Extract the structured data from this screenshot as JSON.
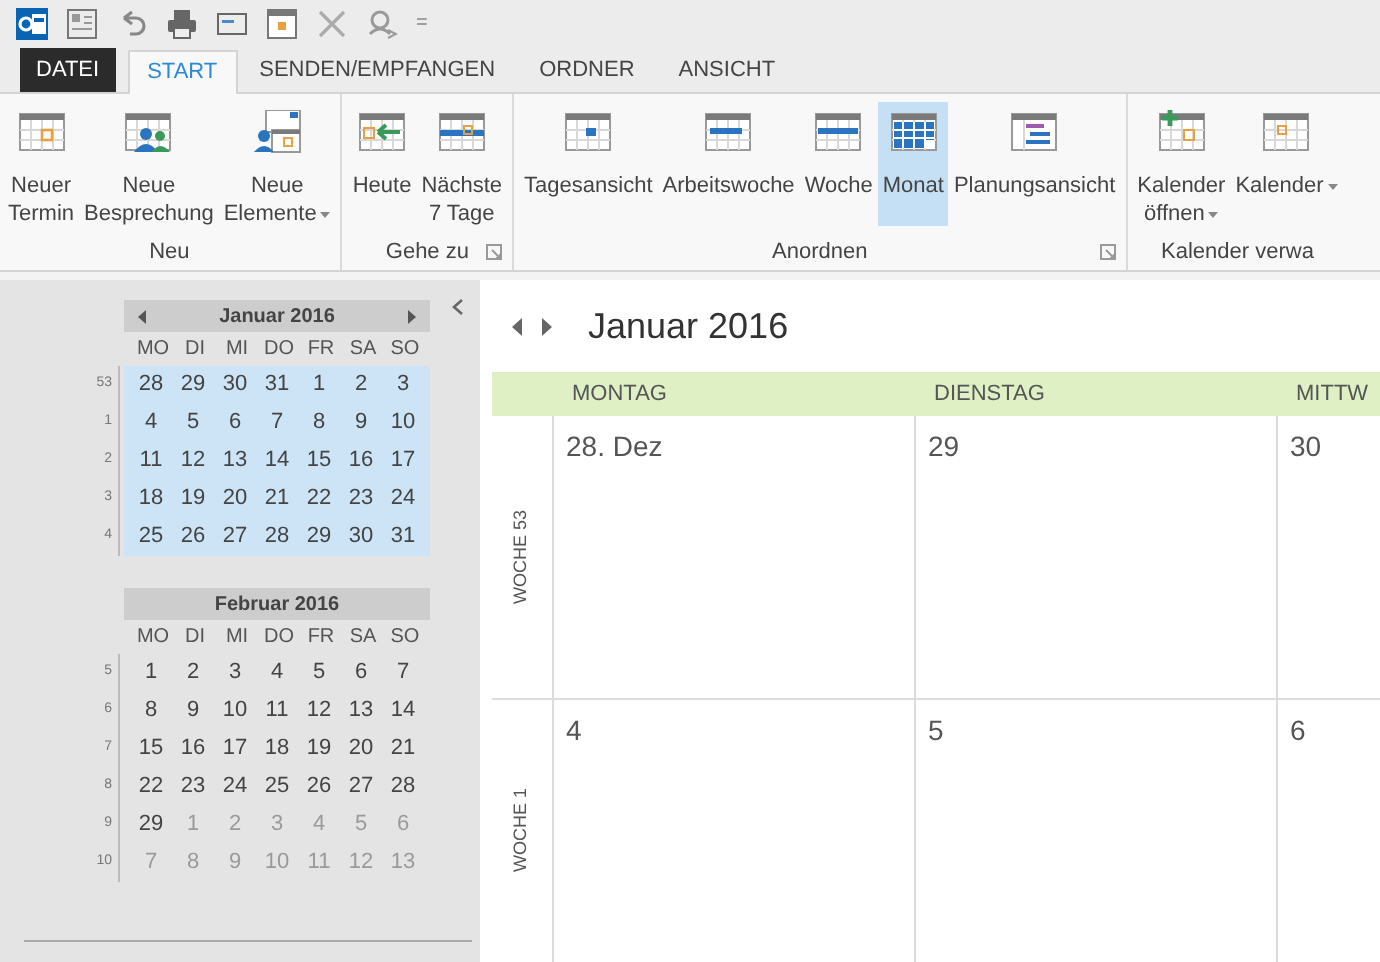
{
  "quick_access": {
    "customize": "="
  },
  "tabs": [
    {
      "label": "DATEI",
      "kind": "file",
      "selected": false
    },
    {
      "label": "START",
      "kind": "tab",
      "selected": true
    },
    {
      "label": "SENDEN/EMPFANGEN",
      "kind": "tab",
      "selected": false
    },
    {
      "label": "ORDNER",
      "kind": "tab",
      "selected": false
    },
    {
      "label": "ANSICHT",
      "kind": "tab",
      "selected": false
    }
  ],
  "ribbon": {
    "groups": [
      {
        "label": "Neu",
        "launcher": false,
        "items": [
          {
            "lines": [
              "Neuer",
              "Termin"
            ],
            "dropdown": false,
            "selected": false
          },
          {
            "lines": [
              "Neue",
              "Besprechung"
            ],
            "dropdown": false,
            "selected": false
          },
          {
            "lines": [
              "Neue",
              "Elemente"
            ],
            "dropdown": true,
            "selected": false
          }
        ]
      },
      {
        "label": "Gehe zu",
        "launcher": true,
        "items": [
          {
            "lines": [
              "Heute"
            ],
            "dropdown": false,
            "selected": false
          },
          {
            "lines": [
              "Nächste",
              "7 Tage"
            ],
            "dropdown": false,
            "selected": false
          }
        ]
      },
      {
        "label": "Anordnen",
        "launcher": true,
        "items": [
          {
            "lines": [
              "Tagesansicht"
            ],
            "dropdown": false,
            "selected": false
          },
          {
            "lines": [
              "Arbeitswoche"
            ],
            "dropdown": false,
            "selected": false
          },
          {
            "lines": [
              "Woche"
            ],
            "dropdown": false,
            "selected": false
          },
          {
            "lines": [
              "Monat"
            ],
            "dropdown": false,
            "selected": true
          },
          {
            "lines": [
              "Planungsansicht"
            ],
            "dropdown": false,
            "selected": false
          }
        ]
      },
      {
        "label": "Kalender verwa",
        "launcher": false,
        "items": [
          {
            "lines": [
              "Kalender",
              "öffnen"
            ],
            "dropdown": true,
            "selected": false
          },
          {
            "lines": [
              "Kalender"
            ],
            "dropdown": true,
            "selected": false
          }
        ]
      }
    ]
  },
  "mini_calendars": [
    {
      "title": "Januar 2016",
      "nav": true,
      "highlighted": true,
      "weekdays": [
        "MO",
        "DI",
        "MI",
        "DO",
        "FR",
        "SA",
        "SO"
      ],
      "weeks": [
        {
          "week": "53",
          "days": [
            {
              "t": "28",
              "dimmed": false
            },
            {
              "t": "29",
              "dimmed": false
            },
            {
              "t": "30",
              "dimmed": false
            },
            {
              "t": "31",
              "dimmed": false
            },
            {
              "t": "1",
              "dimmed": false
            },
            {
              "t": "2",
              "dimmed": false
            },
            {
              "t": "3",
              "dimmed": false
            }
          ]
        },
        {
          "week": "1",
          "days": [
            {
              "t": "4",
              "dimmed": false
            },
            {
              "t": "5",
              "dimmed": false
            },
            {
              "t": "6",
              "dimmed": false
            },
            {
              "t": "7",
              "dimmed": false
            },
            {
              "t": "8",
              "dimmed": false
            },
            {
              "t": "9",
              "dimmed": false
            },
            {
              "t": "10",
              "dimmed": false
            }
          ]
        },
        {
          "week": "2",
          "days": [
            {
              "t": "11",
              "dimmed": false
            },
            {
              "t": "12",
              "dimmed": false
            },
            {
              "t": "13",
              "dimmed": false
            },
            {
              "t": "14",
              "dimmed": false
            },
            {
              "t": "15",
              "dimmed": false
            },
            {
              "t": "16",
              "dimmed": false
            },
            {
              "t": "17",
              "dimmed": false
            }
          ]
        },
        {
          "week": "3",
          "days": [
            {
              "t": "18",
              "dimmed": false
            },
            {
              "t": "19",
              "dimmed": false
            },
            {
              "t": "20",
              "dimmed": false
            },
            {
              "t": "21",
              "dimmed": false
            },
            {
              "t": "22",
              "dimmed": false
            },
            {
              "t": "23",
              "dimmed": false
            },
            {
              "t": "24",
              "dimmed": false
            }
          ]
        },
        {
          "week": "4",
          "days": [
            {
              "t": "25",
              "dimmed": false
            },
            {
              "t": "26",
              "dimmed": false
            },
            {
              "t": "27",
              "dimmed": false
            },
            {
              "t": "28",
              "dimmed": false
            },
            {
              "t": "29",
              "dimmed": false
            },
            {
              "t": "30",
              "dimmed": false
            },
            {
              "t": "31",
              "dimmed": false
            }
          ]
        }
      ]
    },
    {
      "title": "Februar 2016",
      "nav": false,
      "highlighted": false,
      "weekdays": [
        "MO",
        "DI",
        "MI",
        "DO",
        "FR",
        "SA",
        "SO"
      ],
      "weeks": [
        {
          "week": "5",
          "days": [
            {
              "t": "1",
              "dimmed": false
            },
            {
              "t": "2",
              "dimmed": false
            },
            {
              "t": "3",
              "dimmed": false
            },
            {
              "t": "4",
              "dimmed": false
            },
            {
              "t": "5",
              "dimmed": false
            },
            {
              "t": "6",
              "dimmed": false
            },
            {
              "t": "7",
              "dimmed": false
            }
          ]
        },
        {
          "week": "6",
          "days": [
            {
              "t": "8",
              "dimmed": false
            },
            {
              "t": "9",
              "dimmed": false
            },
            {
              "t": "10",
              "dimmed": false
            },
            {
              "t": "11",
              "dimmed": false
            },
            {
              "t": "12",
              "dimmed": false
            },
            {
              "t": "13",
              "dimmed": false
            },
            {
              "t": "14",
              "dimmed": false
            }
          ]
        },
        {
          "week": "7",
          "days": [
            {
              "t": "15",
              "dimmed": false
            },
            {
              "t": "16",
              "dimmed": false
            },
            {
              "t": "17",
              "dimmed": false
            },
            {
              "t": "18",
              "dimmed": false
            },
            {
              "t": "19",
              "dimmed": false
            },
            {
              "t": "20",
              "dimmed": false
            },
            {
              "t": "21",
              "dimmed": false
            }
          ]
        },
        {
          "week": "8",
          "days": [
            {
              "t": "22",
              "dimmed": false
            },
            {
              "t": "23",
              "dimmed": false
            },
            {
              "t": "24",
              "dimmed": false
            },
            {
              "t": "25",
              "dimmed": false
            },
            {
              "t": "26",
              "dimmed": false
            },
            {
              "t": "27",
              "dimmed": false
            },
            {
              "t": "28",
              "dimmed": false
            }
          ]
        },
        {
          "week": "9",
          "days": [
            {
              "t": "29",
              "dimmed": false
            },
            {
              "t": "1",
              "dimmed": true
            },
            {
              "t": "2",
              "dimmed": true
            },
            {
              "t": "3",
              "dimmed": true
            },
            {
              "t": "4",
              "dimmed": true
            },
            {
              "t": "5",
              "dimmed": true
            },
            {
              "t": "6",
              "dimmed": true
            }
          ]
        },
        {
          "week": "10",
          "days": [
            {
              "t": "7",
              "dimmed": true
            },
            {
              "t": "8",
              "dimmed": true
            },
            {
              "t": "9",
              "dimmed": true
            },
            {
              "t": "10",
              "dimmed": true
            },
            {
              "t": "11",
              "dimmed": true
            },
            {
              "t": "12",
              "dimmed": true
            },
            {
              "t": "13",
              "dimmed": true
            }
          ]
        }
      ]
    }
  ],
  "month_view": {
    "title": "Januar 2016",
    "columns": [
      "MONTAG",
      "DIENSTAG",
      "MITTW"
    ],
    "weeks": [
      {
        "label": "WOCHE 53",
        "days": [
          "28. Dez",
          "29",
          "30"
        ]
      },
      {
        "label": "WOCHE 1",
        "days": [
          "4",
          "5",
          "6"
        ]
      }
    ]
  }
}
